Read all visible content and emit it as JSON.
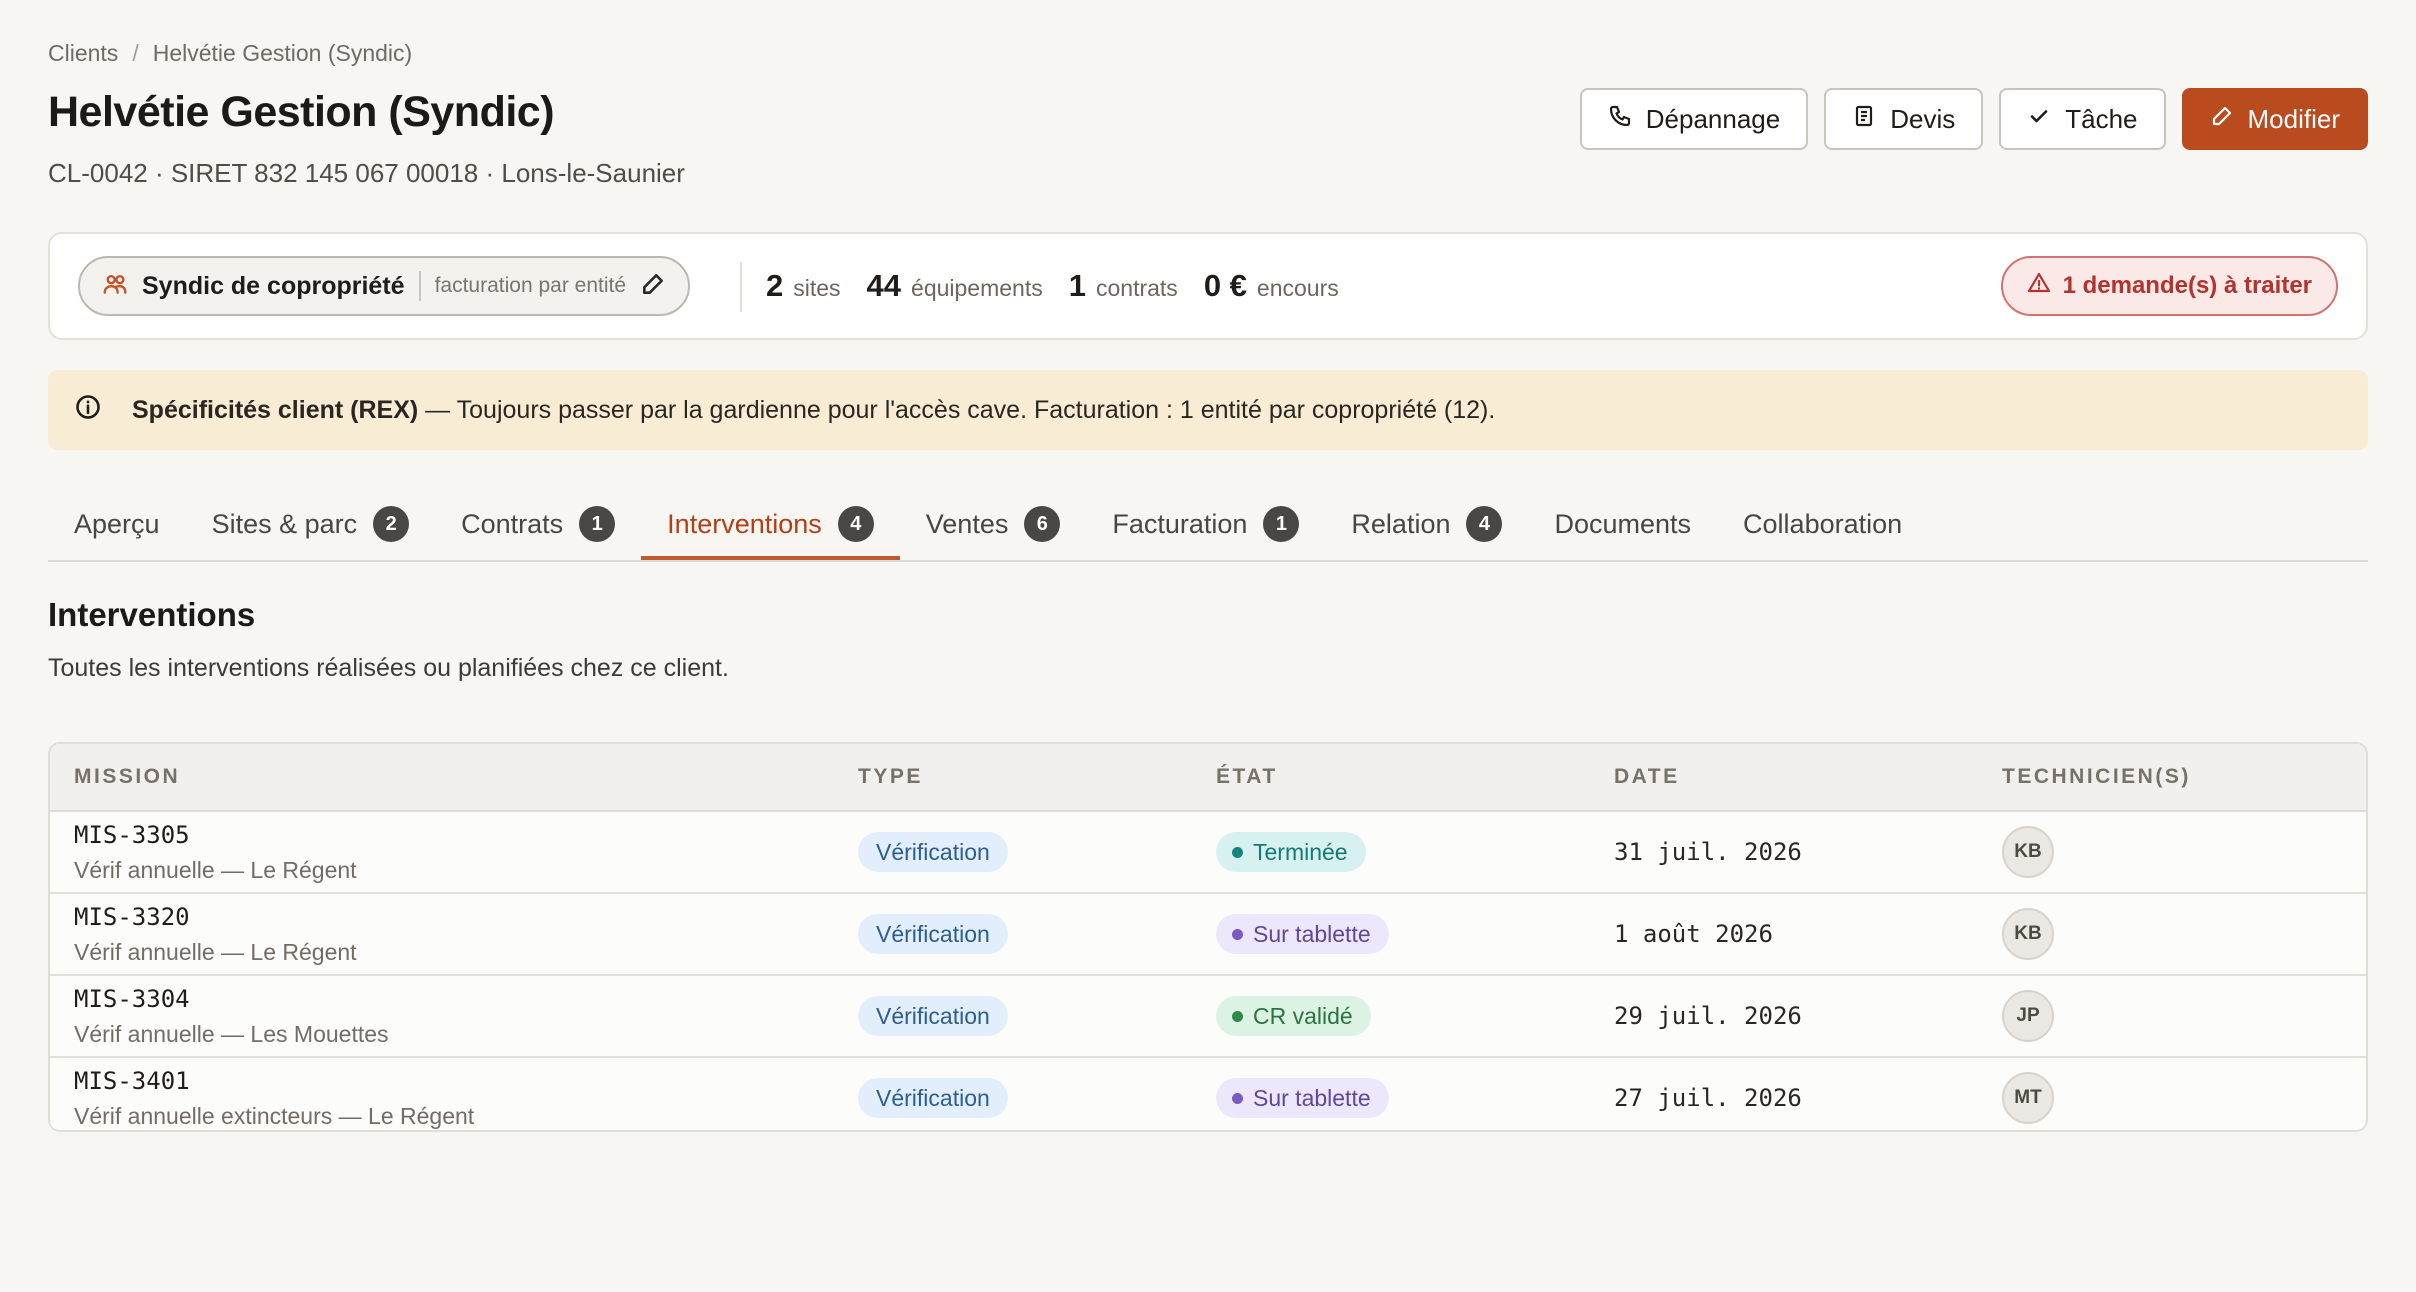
{
  "breadcrumb": {
    "root": "Clients",
    "separator": "/",
    "current": "Helvétie Gestion (Syndic)"
  },
  "header": {
    "title": "Helvétie Gestion (Syndic)",
    "subtitle": "CL-0042 · SIRET 832 145 067 00018 · Lons-le-Saunier",
    "actions": {
      "depannage": "Dépannage",
      "devis": "Devis",
      "tache": "Tâche",
      "modifier": "Modifier"
    }
  },
  "summary": {
    "client_type": "Syndic de copropriété",
    "billing_mode": "facturation par entité",
    "stats": {
      "sites_num": "2",
      "sites_lbl": "sites",
      "equip_num": "44",
      "equip_lbl": "équipements",
      "contracts_num": "1",
      "contracts_lbl": "contrats",
      "encours_num": "0 €",
      "encours_lbl": "encours"
    },
    "alert": "1 demande(s) à traiter"
  },
  "note": {
    "label": "Spécificités client (REX)",
    "text": "— Toujours passer par la gardienne pour l'accès cave. Facturation : 1 entité par copropriété (12)."
  },
  "tabs": [
    {
      "label": "Aperçu",
      "count": ""
    },
    {
      "label": "Sites & parc",
      "count": "2"
    },
    {
      "label": "Contrats",
      "count": "1"
    },
    {
      "label": "Interventions",
      "count": "4"
    },
    {
      "label": "Ventes",
      "count": "6"
    },
    {
      "label": "Facturation",
      "count": "1"
    },
    {
      "label": "Relation",
      "count": "4"
    },
    {
      "label": "Documents",
      "count": ""
    },
    {
      "label": "Collaboration",
      "count": ""
    }
  ],
  "section": {
    "title": "Interventions",
    "description": "Toutes les interventions réalisées ou planifiées chez ce client."
  },
  "table": {
    "headers": {
      "mission": "MISSION",
      "type": "TYPE",
      "state": "ÉTAT",
      "date": "DATE",
      "techs": "TECHNICIEN(S)"
    },
    "rows": [
      {
        "id": "MIS-3305",
        "desc": "Vérif annuelle — Le Régent",
        "type": "Vérification",
        "state": "Terminée",
        "date": "31 juil. 2026",
        "tech": "KB"
      },
      {
        "id": "MIS-3320",
        "desc": "Vérif annuelle — Le Régent",
        "type": "Vérification",
        "state": "Sur tablette",
        "date": "1 août 2026",
        "tech": "KB"
      },
      {
        "id": "MIS-3304",
        "desc": "Vérif annuelle — Les Mouettes",
        "type": "Vérification",
        "state": "CR validé",
        "date": "29 juil. 2026",
        "tech": "JP"
      },
      {
        "id": "MIS-3401",
        "desc": "Vérif annuelle extincteurs — Le Régent",
        "type": "Vérification",
        "state": "Sur tablette",
        "date": "27 juil. 2026",
        "tech": "MT"
      }
    ]
  },
  "colors": {
    "accent": "#b94b1e",
    "state_terminee_bg": "#d6f1f0",
    "state_terminee_fg": "#157a74",
    "state_terminee_dot": "#13857e",
    "state_tablette_bg": "#ece7fa",
    "state_tablette_fg": "#5b4a99",
    "state_tablette_dot": "#7a5bc0",
    "state_valide_bg": "#dcf2e2",
    "state_valide_fg": "#2a7441",
    "state_valide_dot": "#2d8a4a"
  },
  "icons": {
    "depannage": "phone-icon",
    "devis": "document-icon",
    "tache": "check-icon",
    "modifier": "pencil-icon",
    "client_type": "users-icon",
    "billing_edit": "pencil-icon",
    "alert": "warning-icon",
    "note": "info-icon"
  }
}
